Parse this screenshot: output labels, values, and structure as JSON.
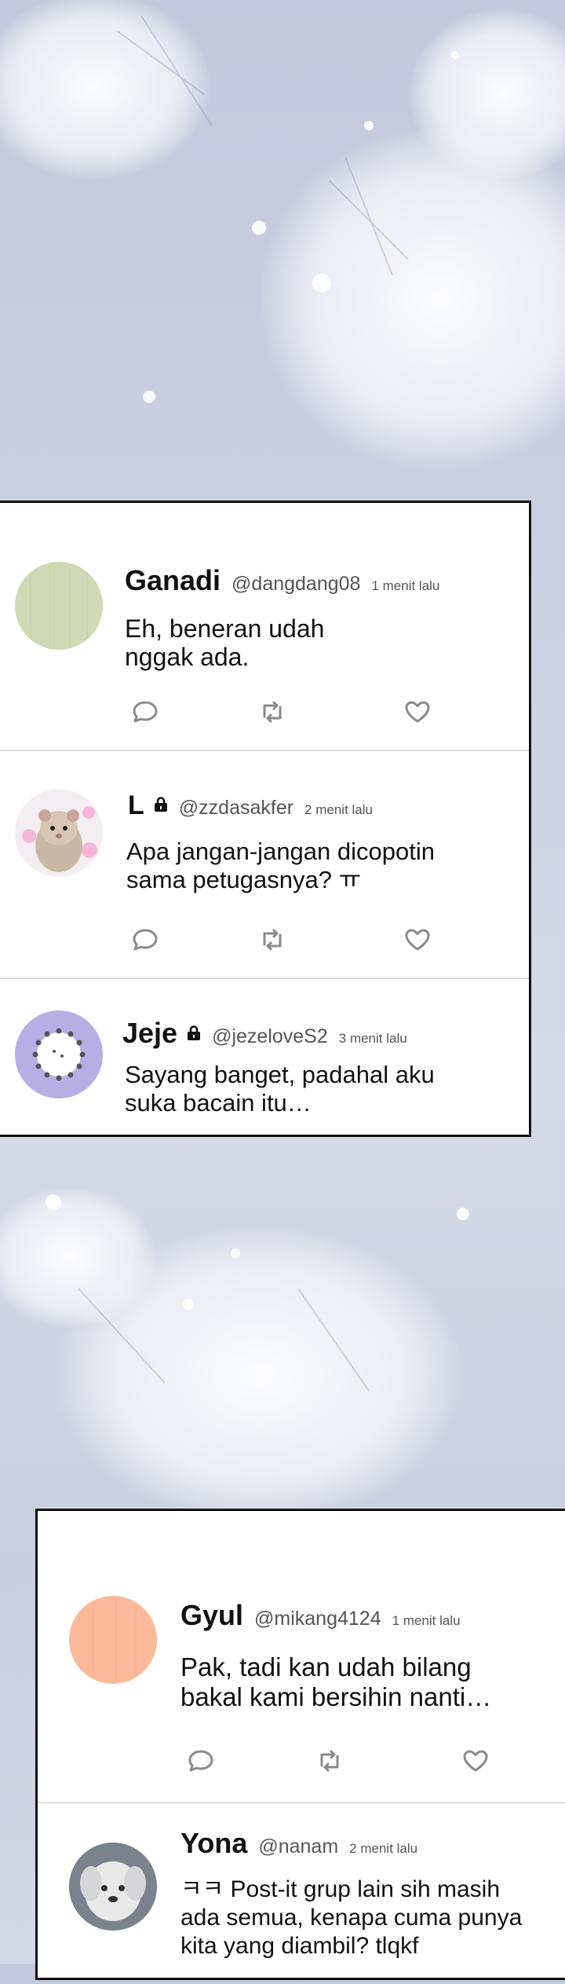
{
  "posts_group_1": [
    {
      "name": "Ganadi",
      "handle": "@dangdang08",
      "time": "1 menit lalu",
      "text": "Eh, beneran udah\nnggak ada.",
      "avatar_icon": "green-avatar",
      "locked": false
    },
    {
      "name": "L",
      "handle": "@zzdasakfer",
      "time": "2 menit lalu",
      "text": "Apa jangan-jangan dicopotin\nsama petugasnya? ㅠ",
      "avatar_icon": "hamster-avatar",
      "locked": true
    },
    {
      "name": "Jeje",
      "handle": "@jezeloveS2",
      "time": "3 menit lalu",
      "text": "Sayang banget, padahal aku\nsuka bacain itu…",
      "avatar_icon": "purple-circle-avatar",
      "locked": true
    }
  ],
  "posts_group_2": [
    {
      "name": "Gyul",
      "handle": "@mikang4124",
      "time": "1 menit lalu",
      "text": "Pak, tadi kan udah bilang\nbakal kami bersihin nanti…",
      "avatar_icon": "orange-avatar",
      "locked": false
    },
    {
      "name": "Yona",
      "handle": "@nanam",
      "time": "2 menit lalu",
      "text": "ㅋㅋ Post-it grup lain sih masih\nada semua, kenapa cuma punya\nkita yang diambil? tlqkf",
      "avatar_icon": "dog-photo-avatar",
      "locked": false
    }
  ],
  "icons": {
    "reply": "speech-bubble-icon",
    "repost": "repost-arrows-icon",
    "like": "heart-icon",
    "lock": "lock-icon"
  },
  "colors": {
    "panel_border": "#111111",
    "avatar_green": "#cfdab4",
    "avatar_orange": "#fcb99a",
    "avatar_purple": "#b7aee6",
    "icon_gray": "#8a8a8a"
  }
}
